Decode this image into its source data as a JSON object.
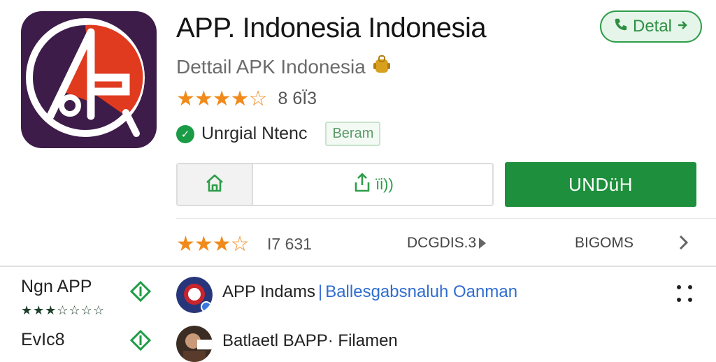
{
  "app": {
    "title": "APP. Indonesia Indonesia",
    "subtitle": "Dettail APK Indonesia",
    "rating_stars": "★★★★☆",
    "rating_count": "8 6Ï3",
    "developer": "Unrgial Ntenc",
    "badge": "Beram"
  },
  "header": {
    "detail_button": "Detal"
  },
  "actions": {
    "share_label": "ïi))",
    "download_label": "UNDüH"
  },
  "stats": {
    "stars": "★★★☆",
    "count": "I7 631",
    "downloads": "DCGDIS.3",
    "category": "BIGOMS"
  },
  "side": {
    "item1": "Ngn APP",
    "item1_stars": "★★★☆☆☆☆",
    "item2": "EvIc8"
  },
  "list": [
    {
      "title": "APP Indams",
      "link": "Ballesgabsnaluh Oanman"
    },
    {
      "title": "Batlaetl BAPP· Filamen"
    }
  ],
  "colors": {
    "accent_green": "#1e8f3c",
    "star_orange": "#f08a1c",
    "icon_bg": "#3d1c4a"
  }
}
